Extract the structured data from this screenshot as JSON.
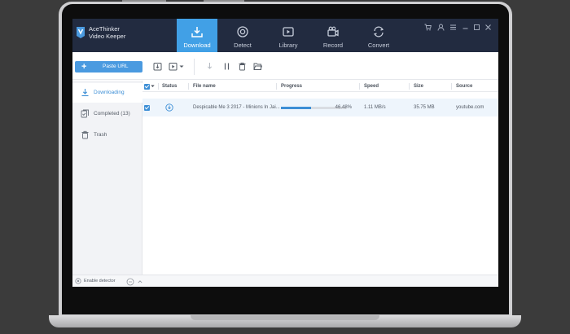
{
  "app": {
    "brand_name": "AceThinker",
    "brand_sub": "Video Keeper"
  },
  "tabs": [
    {
      "label": "Download",
      "icon": "download-icon",
      "active": true
    },
    {
      "label": "Detect",
      "icon": "detect-icon",
      "active": false
    },
    {
      "label": "Library",
      "icon": "library-icon",
      "active": false
    },
    {
      "label": "Record",
      "icon": "record-icon",
      "active": false
    },
    {
      "label": "Convert",
      "icon": "convert-icon",
      "active": false
    }
  ],
  "window_controls": [
    "cart-icon",
    "user-icon",
    "menu-icon",
    "minimize-icon",
    "maximize-icon",
    "close-icon"
  ],
  "toolbar": {
    "paste_label": "Paste URL",
    "icons": [
      "import-file-icon",
      "save-options-icon",
      "start-download-icon",
      "pause-icon",
      "delete-icon",
      "open-folder-icon"
    ]
  },
  "sidebar": {
    "items": [
      {
        "label": "Downloading",
        "icon": "download-arrow-icon",
        "active": true
      },
      {
        "label": "Completed (13)",
        "icon": "completed-files-icon",
        "active": false
      },
      {
        "label": "Trash",
        "icon": "trash-icon",
        "active": false
      }
    ]
  },
  "table": {
    "headers": {
      "status": "Status",
      "file_name": "File name",
      "progress": "Progress",
      "speed": "Speed",
      "size": "Size",
      "source": "Source"
    },
    "rows": [
      {
        "checked": true,
        "status_icon": "downloading-status-icon",
        "file_name": "Despicable Me 3  2017 - Minions In Jai...",
        "progress_percent": 46.48,
        "progress_label": "46.48%",
        "speed": "1.11 MB/s",
        "size": "35.75 MB",
        "source": "youtube.com"
      }
    ]
  },
  "footer": {
    "enable_label": "Enable detector"
  },
  "colors": {
    "titlebar": "#222b40",
    "accent": "#41a0e6",
    "button": "#4a9ae0",
    "row_highlight": "#eef5fc"
  }
}
